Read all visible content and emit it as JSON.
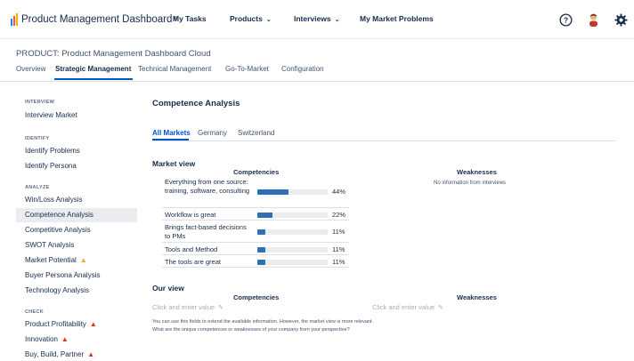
{
  "topnav": {
    "brand": "Product Management Dashboard",
    "brand_mark": "®",
    "items": [
      "My Tasks",
      "Products",
      "Interviews",
      "My Market Problems"
    ],
    "chevron": "⌄",
    "icons": [
      "help-icon",
      "user-avatar-icon",
      "gear-icon"
    ]
  },
  "header": {
    "product_title": "PRODUCT: Product Management Dashboard Cloud",
    "tabs": [
      "Overview",
      "Strategic Management",
      "Technical Management",
      "Go-To-Market",
      "Configuration"
    ],
    "active_tab": 1
  },
  "sidebar": {
    "groups": [
      {
        "heading": "INTERVIEW",
        "items": [
          {
            "label": "Interview Market"
          }
        ]
      },
      {
        "heading": "IDENTIFY",
        "items": [
          {
            "label": "Identify Problems"
          },
          {
            "label": "Identify Persona"
          }
        ]
      },
      {
        "heading": "ANALYZE",
        "items": [
          {
            "label": "Win/Loss Analysis"
          },
          {
            "label": "Competence Analysis",
            "active": true
          },
          {
            "label": "Competitive Analysis"
          },
          {
            "label": "SWOT Analysis"
          },
          {
            "label": "Market Potential",
            "warning": "yellow"
          },
          {
            "label": "Buyer Persona Analysis"
          },
          {
            "label": "Technology Analysis"
          }
        ]
      },
      {
        "heading": "CHECK",
        "items": [
          {
            "label": "Product Profitability",
            "warning": "red"
          },
          {
            "label": "Innovation",
            "warning": "red"
          },
          {
            "label": "Buy, Build, Partner",
            "warning": "red"
          }
        ]
      }
    ]
  },
  "main": {
    "title": "Competence Analysis",
    "market_tabs": [
      "All Markets",
      "Germany",
      "Switzerland"
    ],
    "active_market": 0,
    "market_view": {
      "title": "Market view",
      "competencies_head": "Competencies",
      "weaknesses_head": "Weaknesses",
      "no_info": "No information from interviews",
      "competencies": [
        {
          "label": "Everything from one source: training, software, consulting",
          "percent": 44,
          "percent_label": "44%"
        },
        {
          "label": "Workflow is great",
          "percent": 22,
          "percent_label": "22%"
        },
        {
          "label": "Brings fact-based decisions to PMs",
          "percent": 11,
          "percent_label": "11%"
        },
        {
          "label": "Tools and Method",
          "percent": 11,
          "percent_label": "11%"
        },
        {
          "label": "The tools are great",
          "percent": 11,
          "percent_label": "11%"
        }
      ]
    },
    "our_view": {
      "title": "Our view",
      "competencies_head": "Competencies",
      "weaknesses_head": "Weaknesses",
      "placeholder": "Click and enter value",
      "help_line1": "You can use this fields to extend the available information. However, the market view is more relevant.",
      "help_line2": "What are the unique competences or weaknesses of your company from your perspective?"
    }
  },
  "colors": {
    "accent": "#0052cc",
    "bar": "#2f6fb6",
    "warning_yellow": "#f5a623",
    "warning_red": "#de350b"
  }
}
